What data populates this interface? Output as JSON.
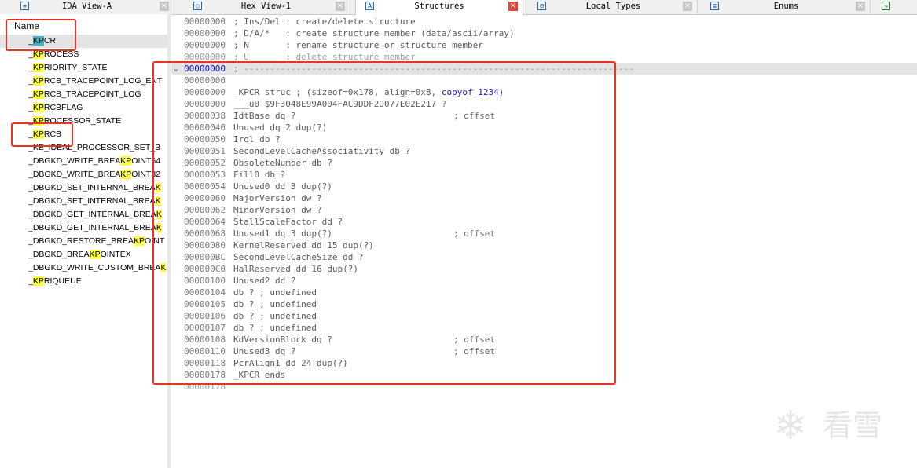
{
  "tabs": [
    {
      "label": "IDA View-A",
      "icon": "listing-icon",
      "close": "×"
    },
    {
      "label": "Hex View-1",
      "icon": "hex-icon",
      "close": "×"
    },
    {
      "label": "Structures",
      "icon": "structures-icon",
      "close": "×",
      "active": true
    },
    {
      "label": "Local Types",
      "icon": "local-types-icon",
      "close": "×"
    },
    {
      "label": "Enums",
      "icon": "enums-icon",
      "close": "×"
    },
    {
      "label": "",
      "icon": "imports-icon"
    }
  ],
  "left_panel": {
    "header": "Name",
    "search_highlight": "KP",
    "items": [
      {
        "pre": "_",
        "hl": "KP",
        "post": "CR",
        "selected": true
      },
      {
        "pre": "_",
        "hl": "KP",
        "post": "ROCESS"
      },
      {
        "pre": "_",
        "hl": "KP",
        "post": "RIORITY_STATE"
      },
      {
        "pre": "_",
        "hl": "KP",
        "post": "RCB_TRACEPOINT_LOG_ENT"
      },
      {
        "pre": "_",
        "hl": "KP",
        "post": "RCB_TRACEPOINT_LOG"
      },
      {
        "pre": "_",
        "hl": "KP",
        "post": "RCBFLAG"
      },
      {
        "pre": "_",
        "hl": "KP",
        "post": "ROCESSOR_STATE"
      },
      {
        "pre": "_",
        "hl": "KP",
        "post": "RCB"
      },
      {
        "pre": "_KE_IDEAL_PROCESSOR_SET_B",
        "hl": "",
        "post": ""
      },
      {
        "pre": "_DBGKD_WRITE_BREA",
        "hl": "KP",
        "post": "OINT64"
      },
      {
        "pre": "_DBGKD_WRITE_BREA",
        "hl": "KP",
        "post": "OINT32"
      },
      {
        "pre": "_DBGKD_SET_INTERNAL_BREA",
        "hl": "K",
        "post": ""
      },
      {
        "pre": "_DBGKD_SET_INTERNAL_BREA",
        "hl": "K",
        "post": ""
      },
      {
        "pre": "_DBGKD_GET_INTERNAL_BREA",
        "hl": "K",
        "post": ""
      },
      {
        "pre": "_DBGKD_GET_INTERNAL_BREA",
        "hl": "K",
        "post": ""
      },
      {
        "pre": "_DBGKD_RESTORE_BREA",
        "hl": "KP",
        "post": "OINT"
      },
      {
        "pre": "_DBGKD_BREA",
        "hl": "KP",
        "post": "OINTEX"
      },
      {
        "pre": "_DBGKD_WRITE_CUSTOM_BREA",
        "hl": "K",
        "post": ""
      },
      {
        "pre": "_",
        "hl": "KP",
        "post": "RIQUEUE"
      }
    ]
  },
  "listing": [
    {
      "addr": "00000000",
      "text": "; Ins/Del : create/delete structure"
    },
    {
      "addr": "00000000",
      "text": "; D/A/*   : create structure member (data/ascii/array)"
    },
    {
      "addr": "00000000",
      "text": "; N       : rename structure or structure member"
    },
    {
      "addr": "00000000",
      "text": "; U       : delete structure member",
      "faint": true
    },
    {
      "addr": "00000000",
      "text": "; ---------------------------------------------------------------------------",
      "header": true
    },
    {
      "addr": "00000000",
      "text": ""
    },
    {
      "addr": "00000000",
      "text": "_KPCR struc ; (sizeof=0x178, align=0x8, ",
      "ref": "copyof_1234",
      "after": ")"
    },
    {
      "addr": "00000000",
      "text": "___u0 $9F3048E99A004FAC9DDF2D077E02E217 ?"
    },
    {
      "addr": "00000038",
      "text": "IdtBase dq ?",
      "comment": "; offset"
    },
    {
      "addr": "00000040",
      "text": "Unused dq 2 dup(?)"
    },
    {
      "addr": "00000050",
      "text": "Irql db ?"
    },
    {
      "addr": "00000051",
      "text": "SecondLevelCacheAssociativity db ?"
    },
    {
      "addr": "00000052",
      "text": "ObsoleteNumber db ?"
    },
    {
      "addr": "00000053",
      "text": "Fill0 db ?"
    },
    {
      "addr": "00000054",
      "text": "Unused0 dd 3 dup(?)"
    },
    {
      "addr": "00000060",
      "text": "MajorVersion dw ?"
    },
    {
      "addr": "00000062",
      "text": "MinorVersion dw ?"
    },
    {
      "addr": "00000064",
      "text": "StallScaleFactor dd ?"
    },
    {
      "addr": "00000068",
      "text": "Unused1 dq 3 dup(?)",
      "comment": "; offset"
    },
    {
      "addr": "00000080",
      "text": "KernelReserved dd 15 dup(?)"
    },
    {
      "addr": "000000BC",
      "text": "SecondLevelCacheSize dd ?"
    },
    {
      "addr": "000000C0",
      "text": "HalReserved dd 16 dup(?)"
    },
    {
      "addr": "00000100",
      "text": "Unused2 dd ?"
    },
    {
      "addr": "00000104",
      "text": "db ? ; undefined"
    },
    {
      "addr": "00000105",
      "text": "db ? ; undefined"
    },
    {
      "addr": "00000106",
      "text": "db ? ; undefined"
    },
    {
      "addr": "00000107",
      "text": "db ? ; undefined"
    },
    {
      "addr": "00000108",
      "text": "KdVersionBlock dq ?",
      "comment": "; offset"
    },
    {
      "addr": "00000110",
      "text": "Unused3 dq ?",
      "comment": "; offset"
    },
    {
      "addr": "00000118",
      "text": "PcrAlign1 dd 24 dup(?)"
    },
    {
      "addr": "00000178",
      "text": "_KPCR ends"
    },
    {
      "addr": "00000178",
      "text": "",
      "faint": true
    }
  ],
  "watermark": {
    "text": "看雪",
    "icon": "snowflake-logo"
  },
  "colors": {
    "annotation_red": "#ea3323",
    "search_highlight": "#ffff40",
    "selected_highlight": "#43b5c3",
    "tab_close_active": "#e04a3a",
    "reference_blue": "#1a1acc"
  }
}
